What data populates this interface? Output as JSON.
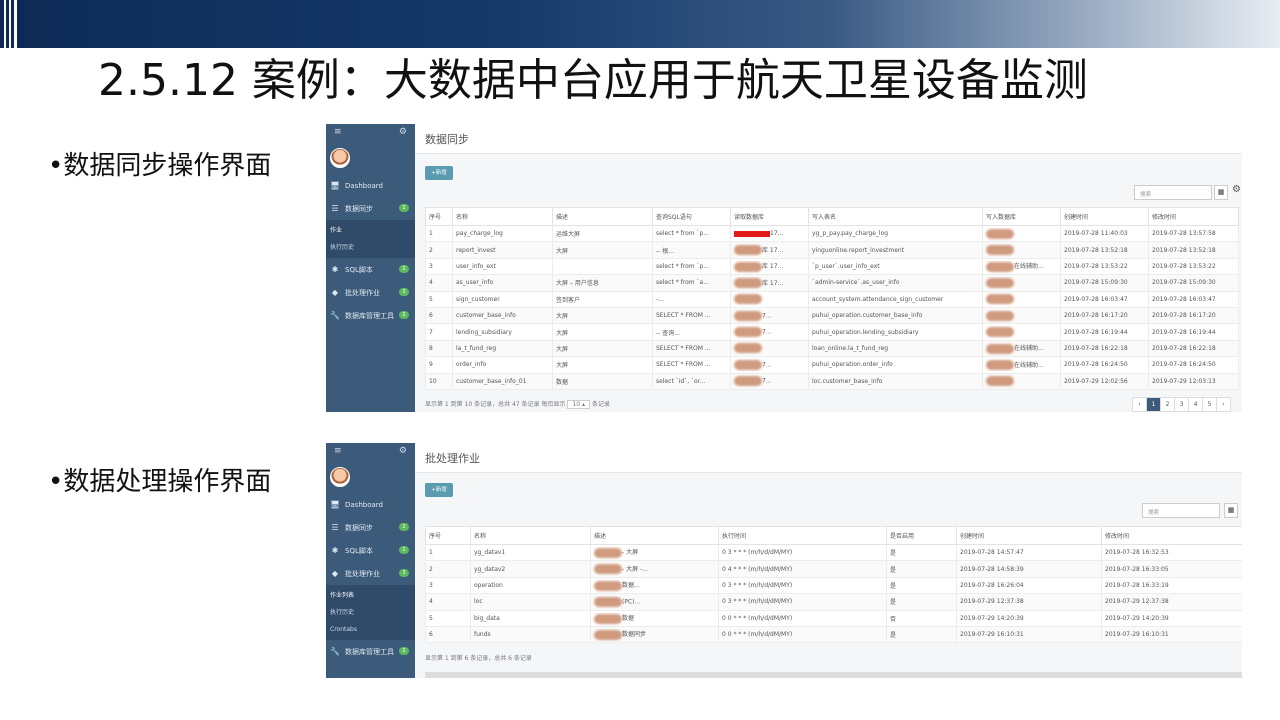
{
  "slide_title": "2.5.12 案例：大数据中台应用于航天卫星设备监测",
  "bullets": [
    "•数据同步操作界面",
    "•数据处理操作界面"
  ],
  "sidebar_common": {
    "menu_icon": "≡",
    "settings_icon": "⚙",
    "items": [
      {
        "label": "Dashboard",
        "icon": "🖥",
        "badge": ""
      },
      {
        "label": "数据同步",
        "icon": "☰",
        "badge": "2"
      },
      {
        "label": "SQL脚本",
        "icon": "✱",
        "badge": "2"
      },
      {
        "label": "批处理作业",
        "icon": "◆",
        "badge": "3"
      },
      {
        "label": "数据库管理工具",
        "icon": "🔧",
        "badge": "2"
      }
    ]
  },
  "sync": {
    "sub_items": [
      "作业",
      "执行历史"
    ],
    "header": "数据同步",
    "add_label": "+新增",
    "search_placeholder": "搜索",
    "columns": [
      "序号",
      "名称",
      "描述",
      "查询SQL语句",
      "读取数据库",
      "写入表名",
      "写入数据库",
      "创建时间",
      "修改时间"
    ],
    "rows": [
      [
        "1",
        "pay_charge_log",
        "运维大屏",
        "select * from `p...",
        "17...",
        "yg_p_pay.pay_charge_log",
        "",
        "2019-07-28 11:40:03",
        "2019-07-28 13:57:58"
      ],
      [
        "2",
        "report_invest",
        "大屏",
        "-- 根...",
        "库 17...",
        "yinguonline.report_investment",
        "",
        "2019-07-28 13:52:18",
        "2019-07-28 13:52:18"
      ],
      [
        "3",
        "user_info_ext",
        "",
        "select * from `p...",
        "库 17...",
        "`p_user`.user_info_ext",
        "在线辅助...",
        "2019-07-28 13:53:22",
        "2019-07-28 13:53:22"
      ],
      [
        "4",
        "as_user_info",
        "大屏 – 用户信息",
        "select * from `a...",
        "库 17...",
        "`admin-service`.as_user_info",
        "",
        "2019-07-28 15:09:30",
        "2019-07-28 15:09:30"
      ],
      [
        "5",
        "sign_customer",
        "签到客户",
        "-...",
        "",
        "account_system.attendance_sign_customer",
        "",
        "2019-07-28 16:03:47",
        "2019-07-28 16:03:47"
      ],
      [
        "6",
        "customer_base_info",
        "大屏",
        "SELECT * FROM ...",
        "7...",
        "puhui_operation.customer_base_info",
        "",
        "2019-07-28 16:17:20",
        "2019-07-28 16:17:20"
      ],
      [
        "7",
        "lending_subsidiary",
        "大屏",
        "-- 查询...",
        "7...",
        "puhui_operation.lending_subsidiary",
        "",
        "2019-07-28 16:19:44",
        "2019-07-28 16:19:44"
      ],
      [
        "8",
        "la_t_fund_reg",
        "大屏",
        "SELECT * FROM ...",
        "",
        "loan_online.la_t_fund_reg",
        "在线辅助...",
        "2019-07-28 16:22:18",
        "2019-07-28 16:22:18"
      ],
      [
        "9",
        "order_info",
        "大屏",
        "SELECT * FROM ...",
        "7...",
        "puhui_operation.order_info",
        "在线辅助...",
        "2019-07-28 16:24:50",
        "2019-07-28 16:24:50"
      ],
      [
        "10",
        "customer_base_info_01",
        "数据",
        "select `id`, `or...",
        "7...",
        "loc.customer_base_info",
        "",
        "2019-07-29 12:02:56",
        "2019-07-29 12:03:13"
      ]
    ],
    "footer_prefix": "显示第 1 到第 10 条记录，总共 47 条记录 每页显示",
    "page_size": "10 ▴",
    "footer_suffix": "条记录",
    "pages": [
      "‹",
      "1",
      "2",
      "3",
      "4",
      "5",
      "›"
    ]
  },
  "batch": {
    "sub_items": [
      "作业列表",
      "执行历史",
      "Crontabs"
    ],
    "header": "批处理作业",
    "add_label": "+新增",
    "search_placeholder": "搜索",
    "columns": [
      "序号",
      "名称",
      "描述",
      "执行时间",
      "是否启用",
      "创建时间",
      "修改时间"
    ],
    "rows": [
      [
        "1",
        "yg_datav1",
        "- 大屏",
        "0 3 * * * (m/h/d/dM/MY)",
        "是",
        "2019-07-28 14:57:47",
        "2019-07-28 16:32:53"
      ],
      [
        "2",
        "yg_datav2",
        "- 大屏 -...",
        "0 4 * * * (m/h/d/dM/MY)",
        "是",
        "2019-07-28 14:58:39",
        "2019-07-28 16:33:05"
      ],
      [
        "3",
        "operation",
        "数据...",
        "0 3 * * * (m/h/d/dM/MY)",
        "是",
        "2019-07-28 16:26:04",
        "2019-07-28 16:33:19"
      ],
      [
        "4",
        "loc",
        "(PC)...",
        "0 3 * * * (m/h/d/dM/MY)",
        "是",
        "2019-07-29 12:37:38",
        "2019-07-29 12:37:38"
      ],
      [
        "5",
        "big_data",
        "数据",
        "0 0 * * * (m/h/d/dM/MY)",
        "否",
        "2019-07-29 14:20:39",
        "2019-07-29 14:20:39"
      ],
      [
        "6",
        "funds",
        "数据同步",
        "0 0 * * * (m/h/d/dM/MY)",
        "是",
        "2019-07-29 16:10:31",
        "2019-07-29 16:10:31"
      ]
    ],
    "footer": "显示第 1 到第 6 条记录，总共 6 条记录"
  }
}
